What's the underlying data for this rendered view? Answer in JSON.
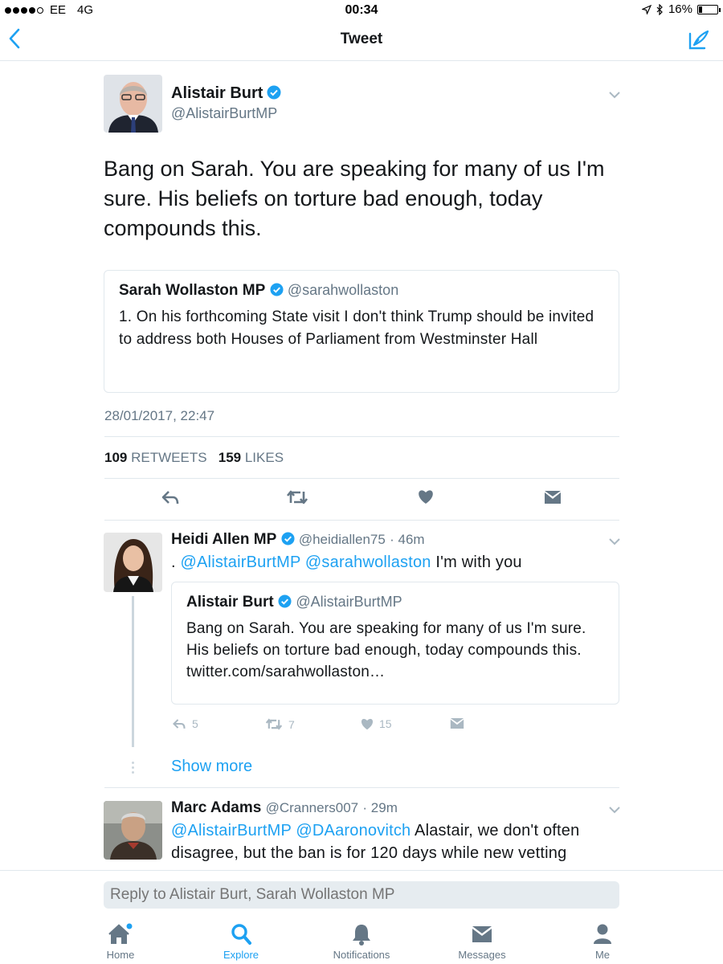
{
  "status": {
    "carrier": "EE",
    "network": "4G",
    "time": "00:34",
    "battery": "16%"
  },
  "nav": {
    "title": "Tweet"
  },
  "tweet": {
    "name": "Alistair Burt",
    "handle": "@AlistairBurtMP",
    "text": "Bang on Sarah. You are speaking for many of us I'm sure. His beliefs on torture bad enough, today compounds this.",
    "quote": {
      "name": "Sarah Wollaston MP",
      "handle": "@sarahwollaston",
      "text": "1. On his forthcoming State visit I don't think Trump should be invited to address both Houses of Parliament from Westminster Hall"
    },
    "timestamp": "28/01/2017, 22:47",
    "retweets": "109",
    "retweets_label": "RETWEETS",
    "likes": "159",
    "likes_label": "LIKES"
  },
  "replies": [
    {
      "name": "Heidi Allen MP",
      "handle": "@heidiallen75",
      "time": "· 46m",
      "prefix": ". ",
      "mention1": "@AlistairBurtMP",
      "mention2": "@sarahwollaston",
      "text": " I'm with you",
      "quote": {
        "name": "Alistair Burt",
        "handle": "@AlistairBurtMP",
        "text": "Bang on Sarah. You are speaking for many of us I'm sure. His beliefs on torture bad enough, today compounds this.  twitter.com/sarahwollaston…"
      },
      "reply_count": "5",
      "retweet_count": "7",
      "like_count": "15",
      "show_more": "Show more"
    },
    {
      "name": "Marc Adams",
      "handle": "@Cranners007",
      "time": "· 29m",
      "mention1": "@AlistairBurtMP",
      "mention2": "@DAaronovitch",
      "text": " Alastair, we don't often disagree, but the ban is for 120 days while new vetting"
    }
  ],
  "reply_bar": {
    "placeholder": "Reply to Alistair Burt, Sarah Wollaston MP"
  },
  "tabs": {
    "home": "Home",
    "explore": "Explore",
    "notifications": "Notifications",
    "messages": "Messages",
    "me": "Me"
  },
  "colors": {
    "accent": "#1da1f2",
    "secondary_text": "#657786",
    "border": "#e1e8ed"
  }
}
